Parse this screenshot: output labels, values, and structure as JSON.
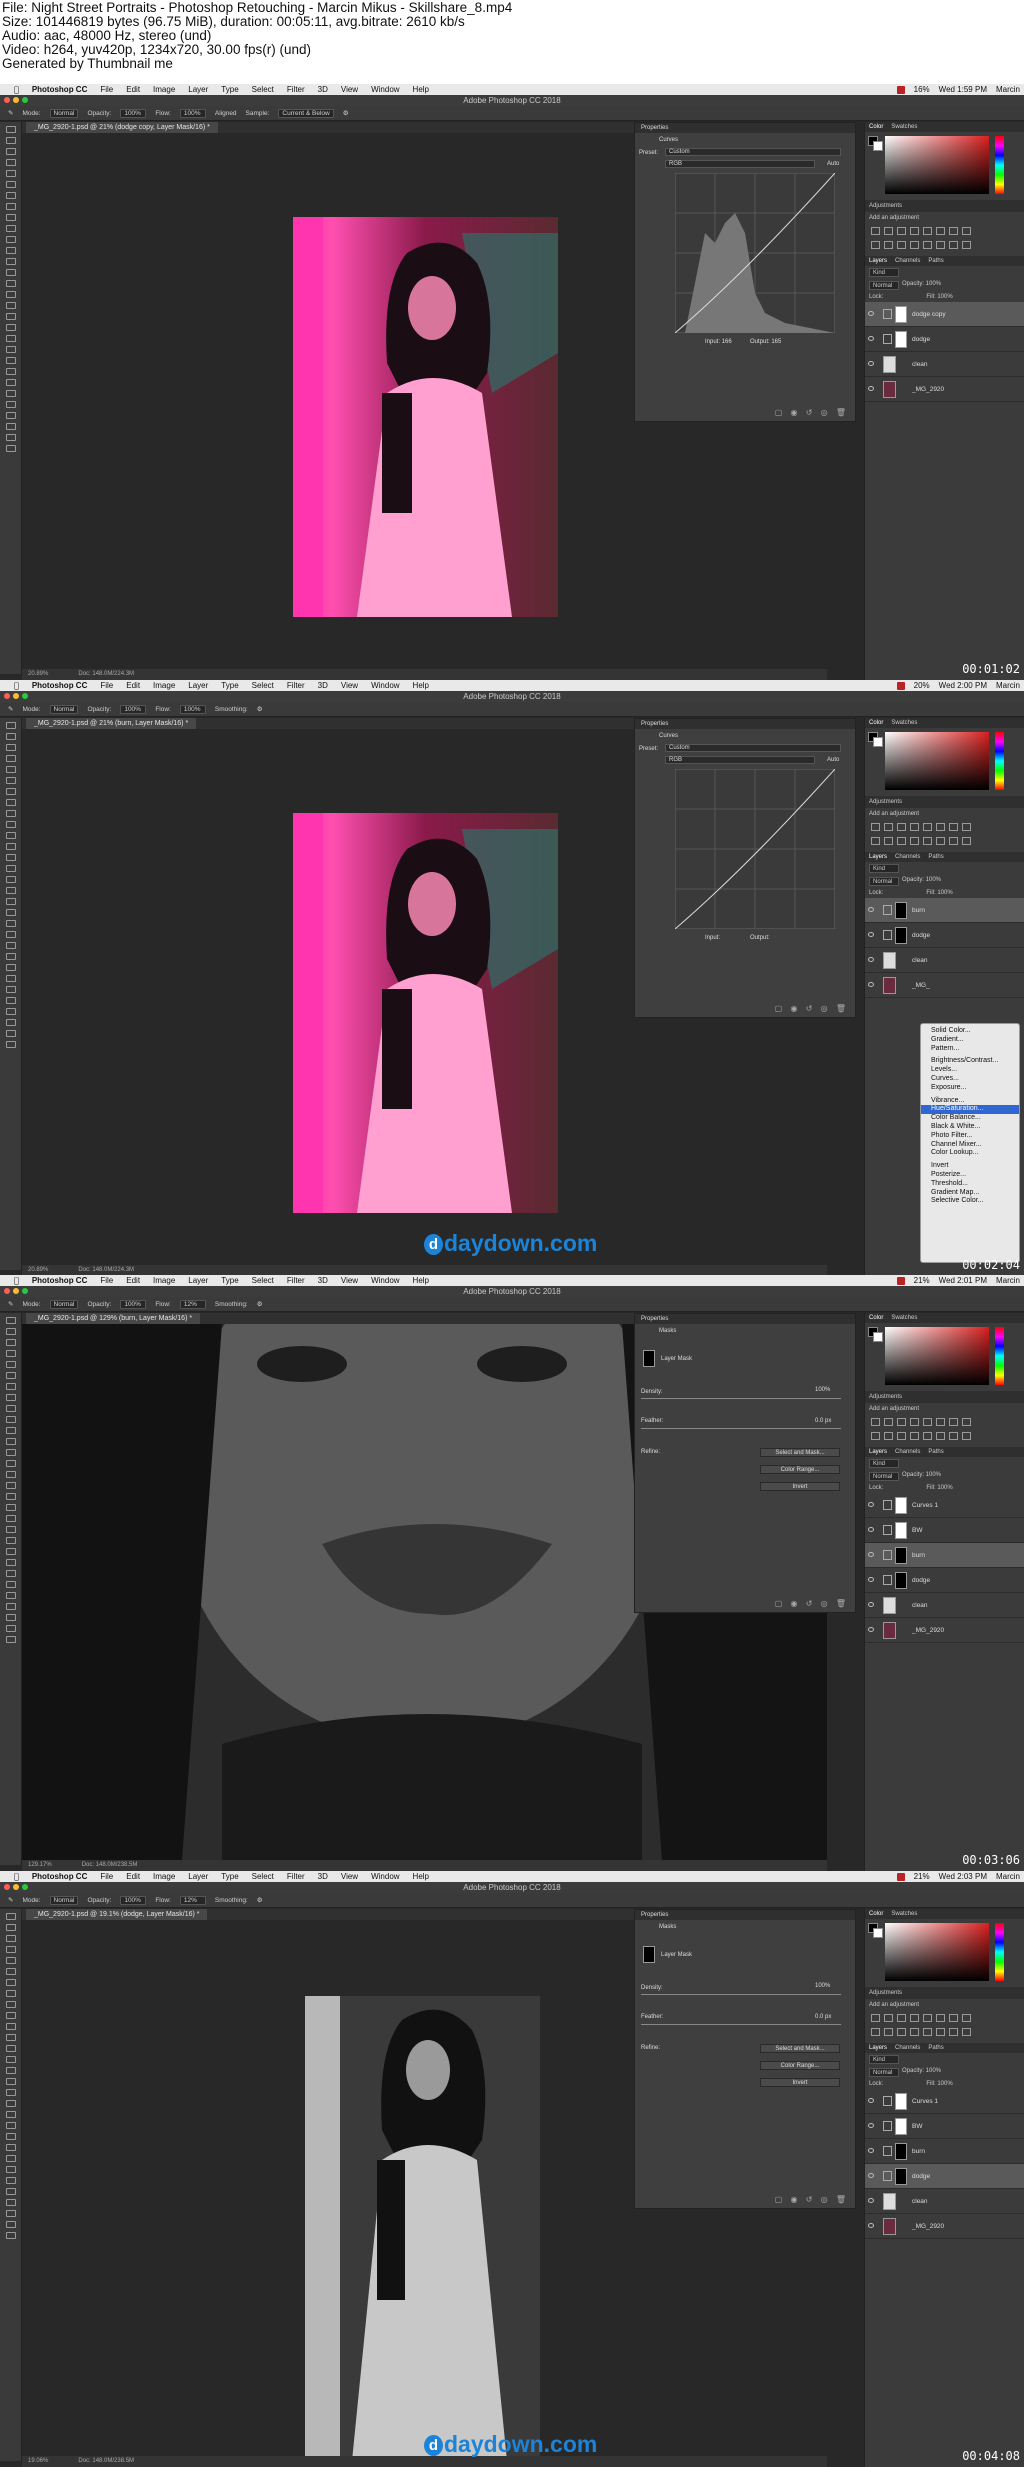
{
  "header": {
    "line1": "File: Night Street Portraits - Photoshop Retouching - Marcin Mikus - Skillshare_8.mp4",
    "line2": "Size: 101446819 bytes (96.75 MiB), duration: 00:05:11, avg.bitrate: 2610 kb/s",
    "line3": "Audio: aac, 48000 Hz, stereo (und)",
    "line4": "Video: h264, yuv420p, 1234x720, 30.00 fps(r) (und)",
    "line5": "Generated by Thumbnail me"
  },
  "menubar": {
    "app": "Photoshop CC",
    "items": [
      "File",
      "Edit",
      "Image",
      "Layer",
      "Type",
      "Select",
      "Filter",
      "3D",
      "View",
      "Window",
      "Help"
    ],
    "user": "Marcin"
  },
  "window_title": "Adobe Photoshop CC 2018",
  "options": {
    "mode_label": "Mode:",
    "mode": "Normal",
    "opacity_label": "Opacity:",
    "opacity": "100%",
    "flow_label": "Flow:",
    "aligned": "Aligned",
    "sample_label": "Sample:",
    "sample": "Current & Below",
    "smoothing": "Smoothing:"
  },
  "panels": {
    "color": "Color",
    "swatches": "Swatches",
    "adjustments": "Adjustments",
    "add_adjustment": "Add an adjustment",
    "layers": "Layers",
    "channels": "Channels",
    "paths": "Paths",
    "properties": "Properties",
    "kind": "Kind",
    "normal": "Normal",
    "opacity": "Opacity: 100%",
    "fill": "Fill: 100%",
    "lock": "Lock:"
  },
  "frames": [
    {
      "doc_tab": "_MG_2920-1.psd @ 21% (dodge copy, Layer Mask/16) *",
      "time": "Wed 1:59 PM",
      "battery": "16%",
      "flow": "100%",
      "zoom": "20.89%",
      "doc": "Doc: 148.0M/224.3M",
      "timecode": "00:01:02",
      "prop_title": "Curves",
      "preset_label": "Preset:",
      "preset": "Custom",
      "channel": "RGB",
      "auto": "Auto",
      "input": "Input: 166",
      "output": "Output: 165",
      "layers": [
        {
          "name": "dodge copy",
          "selected": true,
          "type": "adj"
        },
        {
          "name": "dodge",
          "selected": false,
          "type": "adj"
        },
        {
          "name": "clean",
          "selected": false,
          "type": "img"
        },
        {
          "name": "_MG_2920",
          "selected": false,
          "type": "img"
        }
      ]
    },
    {
      "doc_tab": "_MG_2920-1.psd @ 21% (burn, Layer Mask/16) *",
      "time": "Wed 2:00 PM",
      "battery": "20%",
      "flow": "100%",
      "zoom": "20.89%",
      "doc": "Doc: 148.0M/224.3M",
      "timecode": "00:02:04",
      "watermark": "daydown.com",
      "prop_title": "Curves",
      "preset_label": "Preset:",
      "preset": "Custom",
      "channel": "RGB",
      "auto": "Auto",
      "input": "Input:",
      "output": "Output:",
      "layers": [
        {
          "name": "burn",
          "selected": true,
          "type": "adj"
        },
        {
          "name": "dodge",
          "selected": false,
          "type": "adj"
        },
        {
          "name": "clean",
          "selected": false,
          "type": "img"
        },
        {
          "name": "_MG_",
          "selected": false,
          "type": "img"
        }
      ],
      "menu": [
        "Solid Color...",
        "Gradient...",
        "Pattern...",
        "",
        "Brightness/Contrast...",
        "Levels...",
        "Curves...",
        "Exposure...",
        "",
        "Vibrance...",
        "Hue/Saturation...",
        "Color Balance...",
        "Black & White...",
        "Photo Filter...",
        "Channel Mixer...",
        "Color Lookup...",
        "",
        "Invert",
        "Posterize...",
        "Threshold...",
        "Gradient Map...",
        "Selective Color..."
      ],
      "menu_highlight": "Hue/Saturation..."
    },
    {
      "doc_tab": "_MG_2920-1.psd @ 129% (burn, Layer Mask/16) *",
      "time": "Wed 2:01 PM",
      "battery": "21%",
      "flow": "12%",
      "zoom": "129.17%",
      "doc": "Doc: 148.0M/238.5M",
      "timecode": "00:03:06",
      "prop_title": "Masks",
      "mask_label": "Layer Mask",
      "density_label": "Density:",
      "density": "100%",
      "feather_label": "Feather:",
      "feather": "0.0 px",
      "refine": "Refine:",
      "btn1": "Select and Mask...",
      "btn2": "Color Range...",
      "btn3": "Invert",
      "layers": [
        {
          "name": "Curves 1",
          "selected": false,
          "type": "adj"
        },
        {
          "name": "BW",
          "selected": false,
          "type": "adj"
        },
        {
          "name": "burn",
          "selected": true,
          "type": "adj"
        },
        {
          "name": "dodge",
          "selected": false,
          "type": "adj"
        },
        {
          "name": "clean",
          "selected": false,
          "type": "img"
        },
        {
          "name": "_MG_2920",
          "selected": false,
          "type": "img"
        }
      ]
    },
    {
      "doc_tab": "_MG_2920-1.psd @ 19.1% (dodge, Layer Mask/16) *",
      "time": "Wed 2:03 PM",
      "battery": "21%",
      "flow": "12%",
      "zoom": "19.06%",
      "doc": "Doc: 148.0M/238.5M",
      "timecode": "00:04:08",
      "watermark": "daydown.com",
      "prop_title": "Masks",
      "mask_label": "Layer Mask",
      "density_label": "Density:",
      "density": "100%",
      "feather_label": "Feather:",
      "feather": "0.0 px",
      "refine": "Refine:",
      "btn1": "Select and Mask...",
      "btn2": "Color Range...",
      "btn3": "Invert",
      "layers": [
        {
          "name": "Curves 1",
          "selected": false,
          "type": "adj"
        },
        {
          "name": "BW",
          "selected": false,
          "type": "adj"
        },
        {
          "name": "burn",
          "selected": false,
          "type": "adj"
        },
        {
          "name": "dodge",
          "selected": true,
          "type": "adj"
        },
        {
          "name": "clean",
          "selected": false,
          "type": "img"
        },
        {
          "name": "_MG_2920",
          "selected": false,
          "type": "img"
        }
      ]
    }
  ]
}
